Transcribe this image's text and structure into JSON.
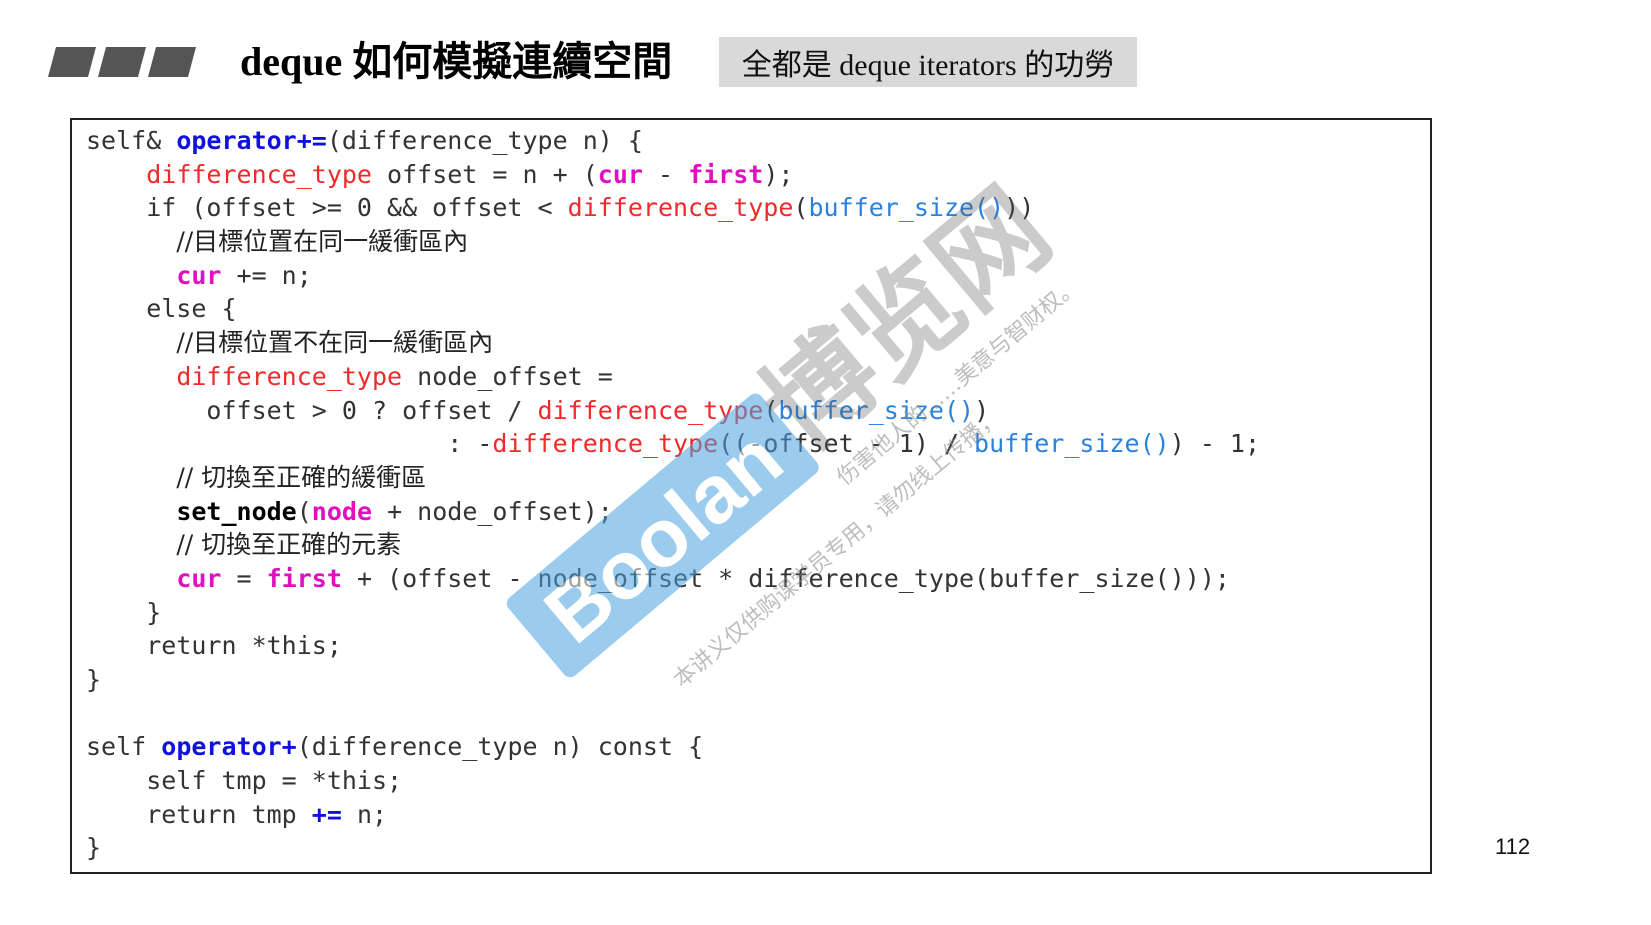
{
  "slide": {
    "title": "deque 如何模擬連續空間",
    "subtitle": "全都是 deque iterators 的功勞",
    "page_number": "112"
  },
  "code": {
    "lines": [
      [
        {
          "t": "self& ",
          "c": "plain"
        },
        {
          "t": "operator+=",
          "c": "kw"
        },
        {
          "t": "(difference_type n) {",
          "c": "plain"
        }
      ],
      [
        {
          "t": "    ",
          "c": "plain"
        },
        {
          "t": "difference_type",
          "c": "type"
        },
        {
          "t": " offset = n + (",
          "c": "plain"
        },
        {
          "t": "cur",
          "c": "mem"
        },
        {
          "t": " - ",
          "c": "plain"
        },
        {
          "t": "first",
          "c": "mem"
        },
        {
          "t": ");",
          "c": "plain"
        }
      ],
      [
        {
          "t": "    if (offset >= 0 && offset < ",
          "c": "plain"
        },
        {
          "t": "difference_type",
          "c": "type"
        },
        {
          "t": "(",
          "c": "plain"
        },
        {
          "t": "buffer_size()",
          "c": "fn"
        },
        {
          "t": "))",
          "c": "plain"
        }
      ],
      [
        {
          "t": "      ",
          "c": "plain"
        },
        {
          "t": "//目標位置在同一緩衝區內",
          "c": "cm"
        }
      ],
      [
        {
          "t": "      ",
          "c": "plain"
        },
        {
          "t": "cur",
          "c": "mem"
        },
        {
          "t": " += n;",
          "c": "plain"
        }
      ],
      [
        {
          "t": "    else {",
          "c": "plain"
        }
      ],
      [
        {
          "t": "      ",
          "c": "plain"
        },
        {
          "t": "//目標位置不在同一緩衝區內",
          "c": "cm"
        }
      ],
      [
        {
          "t": "      ",
          "c": "plain"
        },
        {
          "t": "difference_type",
          "c": "type"
        },
        {
          "t": " node_offset =",
          "c": "plain"
        }
      ],
      [
        {
          "t": "        offset > 0 ? offset / ",
          "c": "plain"
        },
        {
          "t": "difference_type",
          "c": "type"
        },
        {
          "t": "(",
          "c": "plain"
        },
        {
          "t": "buffer_size()",
          "c": "fn"
        },
        {
          "t": ")",
          "c": "plain"
        }
      ],
      [
        {
          "t": "                        : -",
          "c": "plain"
        },
        {
          "t": "difference_type",
          "c": "type"
        },
        {
          "t": "((-offset - 1) / ",
          "c": "plain"
        },
        {
          "t": "buffer_size()",
          "c": "fn"
        },
        {
          "t": ") - 1;",
          "c": "plain"
        }
      ],
      [
        {
          "t": "      ",
          "c": "plain"
        },
        {
          "t": "// 切換至正確的緩衝區",
          "c": "cm"
        }
      ],
      [
        {
          "t": "      ",
          "c": "plain"
        },
        {
          "t": "set_node",
          "c": "bold"
        },
        {
          "t": "(",
          "c": "plain"
        },
        {
          "t": "node",
          "c": "mem"
        },
        {
          "t": " + node_offset);",
          "c": "plain"
        }
      ],
      [
        {
          "t": "      ",
          "c": "plain"
        },
        {
          "t": "// 切換至正確的元素",
          "c": "cm"
        }
      ],
      [
        {
          "t": "      ",
          "c": "plain"
        },
        {
          "t": "cur",
          "c": "mem"
        },
        {
          "t": " = ",
          "c": "plain"
        },
        {
          "t": "first",
          "c": "mem"
        },
        {
          "t": " + (offset - node_offset * difference_type(buffer_size()));",
          "c": "plain"
        }
      ],
      [
        {
          "t": "    }",
          "c": "plain"
        }
      ],
      [
        {
          "t": "    return *this;",
          "c": "plain"
        }
      ],
      [
        {
          "t": "}",
          "c": "plain"
        }
      ],
      [
        {
          "t": "",
          "c": "plain"
        }
      ],
      [
        {
          "t": "self ",
          "c": "plain"
        },
        {
          "t": "operator+",
          "c": "kw"
        },
        {
          "t": "(difference_type n) const {",
          "c": "plain"
        }
      ],
      [
        {
          "t": "    self tmp = *this;",
          "c": "plain"
        }
      ],
      [
        {
          "t": "    return tmp ",
          "c": "plain"
        },
        {
          "t": "+=",
          "c": "kw"
        },
        {
          "t": " n;",
          "c": "plain"
        }
      ],
      [
        {
          "t": "}",
          "c": "plain"
        }
      ]
    ]
  },
  "watermark": {
    "brand_latin": "Boolan",
    "brand_cjk": "博览网",
    "notice_top": "伤害他人的……美意与智财权。",
    "notice_bottom": "本讲义仅供购课学员专用，请勿线上传播，"
  },
  "colors": {
    "keyword": "#1010e0",
    "type": "#ee2a2a",
    "member": "#e010c0",
    "function": "#2a82e0",
    "stripe": "#555555",
    "subtitle_bg": "#d9d9d9",
    "watermark_blue": "#4aa3df"
  },
  "icons": {
    "header_decoration": "slanted-stripes"
  }
}
